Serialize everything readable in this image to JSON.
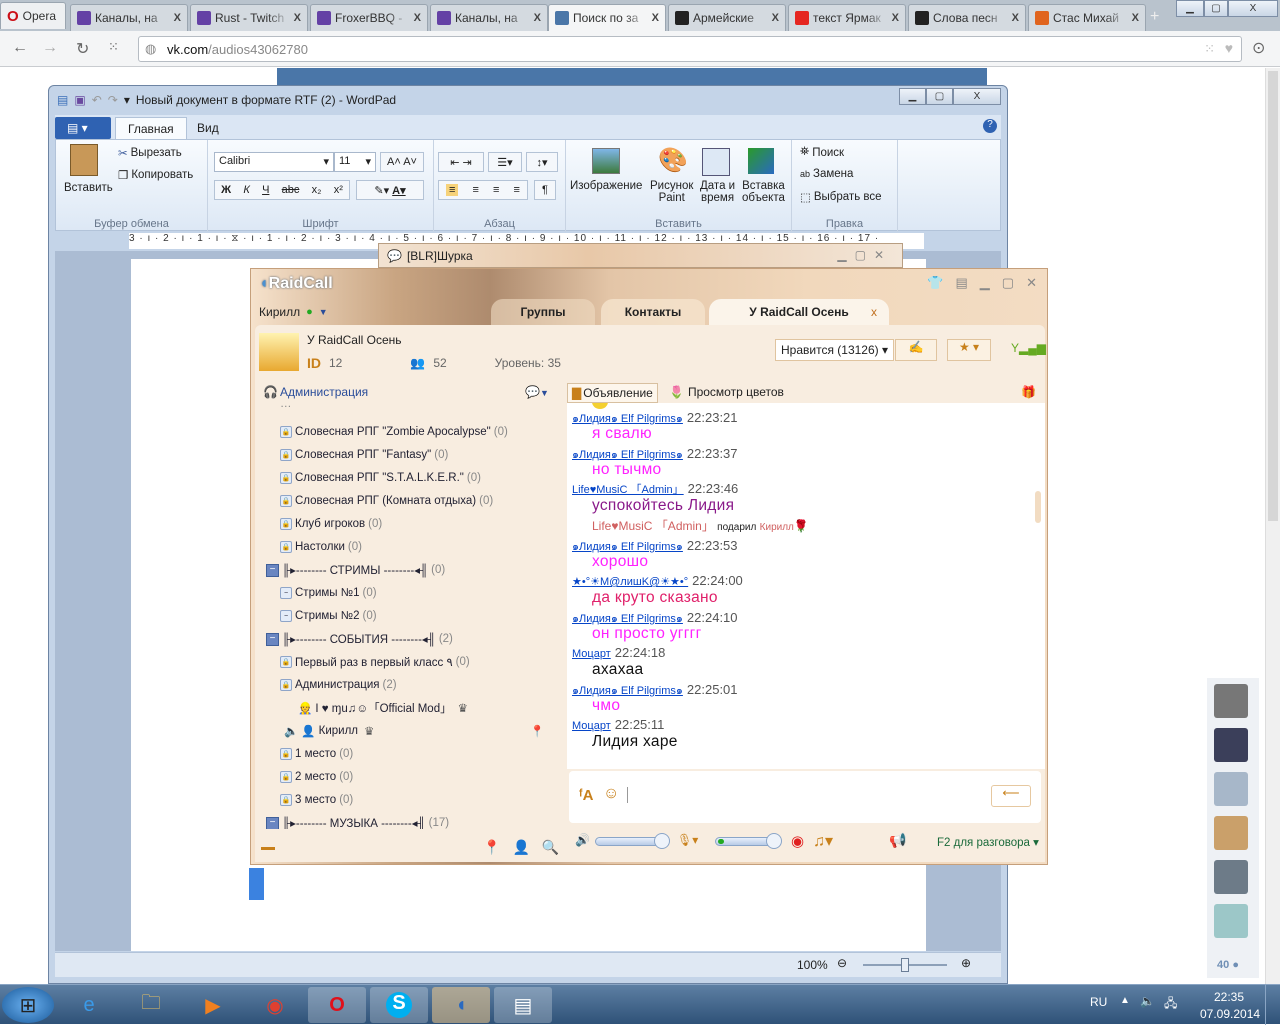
{
  "browser": {
    "menu_label": "Opera",
    "tabs": [
      {
        "title": "Каналы, на",
        "icon": "twitch-icon",
        "color": "#6441a5"
      },
      {
        "title": "Rust - Twitch",
        "icon": "twitch-icon",
        "color": "#6441a5"
      },
      {
        "title": "FroxerBBQ -",
        "icon": "twitch-icon",
        "color": "#6441a5"
      },
      {
        "title": "Каналы, на",
        "icon": "twitch-icon",
        "color": "#6441a5"
      },
      {
        "title": "Поиск по за",
        "icon": "vk-icon",
        "color": "#4a76a8",
        "active": true
      },
      {
        "title": "Армейские",
        "icon": "army-icon",
        "color": "#222"
      },
      {
        "title": "текст Ярмак",
        "icon": "yandex-icon",
        "color": "#e52620"
      },
      {
        "title": "Слова песн",
        "icon": "music-note-icon",
        "color": "#222"
      },
      {
        "title": "Стас Михай",
        "icon": "gl-icon",
        "color": "#e0641e"
      }
    ],
    "url_host": "vk.com",
    "url_path": "/audios43062780"
  },
  "wordpad": {
    "title": "Новый документ в формате RTF (2) - WordPad",
    "tabs": [
      "Главная",
      "Вид"
    ],
    "clipboard": {
      "paste": "Вставить",
      "cut": "Вырезать",
      "copy": "Копировать",
      "label": "Буфер обмена"
    },
    "font": {
      "family": "Calibri",
      "size": "11",
      "label": "Шрифт",
      "bold": "Ж",
      "italic": "К",
      "underline": "Ч",
      "strike": "abc"
    },
    "paragraph": {
      "label": "Абзац"
    },
    "insert": {
      "image": "Изображение",
      "paint1": "Рисунок",
      "paint2": "Paint",
      "date1": "Дата и",
      "date2": "время",
      "obj1": "Вставка",
      "obj2": "объекта",
      "label": "Вставить"
    },
    "edit": {
      "find": "Поиск",
      "replace": "Замена",
      "select_all": "Выбрать все",
      "label": "Правка"
    },
    "ruler": "3 · ı · 2 · ı · 1 · ı · ⧖ · ı · 1 · ı · 2 · ı · 3 · ı · 4 · ı · 5 · ı · 6 · ı · 7 · ı · 8 · ı · 9 · ı · 10 · ı · 11 · ı · 12 · ı · 13 · ı · 14 · ı · 15 · ı · 16 · ı · 17 ·",
    "zoom": "100%",
    "zoom_level": 0.5
  },
  "floating_window": {
    "title": "[BLR]Шурка"
  },
  "raidcall": {
    "logo": "RaidCall",
    "user": "Кирилл",
    "tabs": [
      "Группы",
      "Контакты",
      "У RaidCall Осень"
    ],
    "group": {
      "name": "У RaidCall Осень",
      "id_label": "ID",
      "id": "12",
      "members": "52",
      "level": "Уровень: 35"
    },
    "likes": "Нравится (13126)",
    "admin_link": "Администрация",
    "channels": [
      {
        "type": "room",
        "name": "Словесная РПГ \"Zombie Apocalypse\"",
        "count": "(0)"
      },
      {
        "type": "room",
        "name": "Словесная РПГ \"Fantasy\"",
        "count": "(0)"
      },
      {
        "type": "room",
        "name": "Словесная РПГ \"S.T.A.L.K.E.R.\"",
        "count": "(0)"
      },
      {
        "type": "room",
        "name": "Словесная РПГ (Комната отдыха)",
        "count": "(0)"
      },
      {
        "type": "room",
        "name": "Клуб игроков",
        "count": "(0)"
      },
      {
        "type": "room",
        "name": "Настолки",
        "count": "(0)"
      },
      {
        "type": "group",
        "name": "╟▸-------- СТРИМЫ --------◂╢",
        "count": "(0)"
      },
      {
        "type": "sub",
        "name": "Стримы №1",
        "count": "(0)"
      },
      {
        "type": "sub",
        "name": "Стримы №2",
        "count": "(0)"
      },
      {
        "type": "group",
        "name": "╟▸-------- СОБЫТИЯ --------◂╢",
        "count": "(2)"
      },
      {
        "type": "room",
        "name": "Первый раз в первый класс ٩",
        "count": "(0)"
      },
      {
        "type": "room",
        "name": "Администрация",
        "count": "(2)"
      },
      {
        "type": "user",
        "name": "I ♥ ɱu♫☺「Official Mod」",
        "count": ""
      },
      {
        "type": "me",
        "name": "Кирилл",
        "count": ""
      },
      {
        "type": "room",
        "name": "1 место",
        "count": "(0)"
      },
      {
        "type": "room",
        "name": "2 место",
        "count": "(0)"
      },
      {
        "type": "room",
        "name": "3 место",
        "count": "(0)"
      },
      {
        "type": "group",
        "name": "╟▸-------- МУЗЫКА --------◂╢",
        "count": "(17)"
      }
    ],
    "chat_toolbar": {
      "announce": "Объявление",
      "flowers": "Просмотр цветов"
    },
    "messages": [
      {
        "nick": "๑Лидия๑ Elf Pilgrims๑",
        "time": "22:23:21",
        "text": "я свалю",
        "color": "#ff22ff"
      },
      {
        "nick": "๑Лидия๑ Elf Pilgrims๑",
        "time": "22:23:37",
        "text": "но тычмо",
        "color": "#ff22ff"
      },
      {
        "nick": "Life♥MusiC 「Admin」",
        "time": "22:23:46",
        "text": "успокойтесь Лидия",
        "color": "#8a1a8a"
      },
      {
        "nick": "๑Лидия๑ Elf Pilgrims๑",
        "time": "22:23:53",
        "text": "хорошо",
        "color": "#ff22ff",
        "gift": {
          "from": "Life♥MusiC 「Admin」",
          "verb": "подарил",
          "to": "Кирилл"
        }
      },
      {
        "nick": "★•°☀M@лишK@☀★•°",
        "time": "22:24:00",
        "text": "да круто сказано",
        "color": "#e0206a"
      },
      {
        "nick": "๑Лидия๑ Elf Pilgrims๑",
        "time": "22:24:10",
        "text": "он просто угггг",
        "color": "#ff22ff"
      },
      {
        "nick": "Моцарт",
        "time": "22:24:18",
        "text": "ахахаа",
        "color": "#111"
      },
      {
        "nick": "๑Лидия๑ Elf Pilgrims๑",
        "time": "22:25:01",
        "text": "чмо",
        "color": "#ff22ff"
      },
      {
        "nick": "Моцарт",
        "time": "22:25:11",
        "text": "Лидия харе",
        "color": "#111"
      }
    ],
    "ptt": "F2 для разговора",
    "speaker_volume": 1.0,
    "mic_volume": 1.0
  },
  "vk": {
    "online_count": "40"
  },
  "taskbar": {
    "lang": "RU",
    "time": "22:35",
    "date": "07.09.2014"
  }
}
